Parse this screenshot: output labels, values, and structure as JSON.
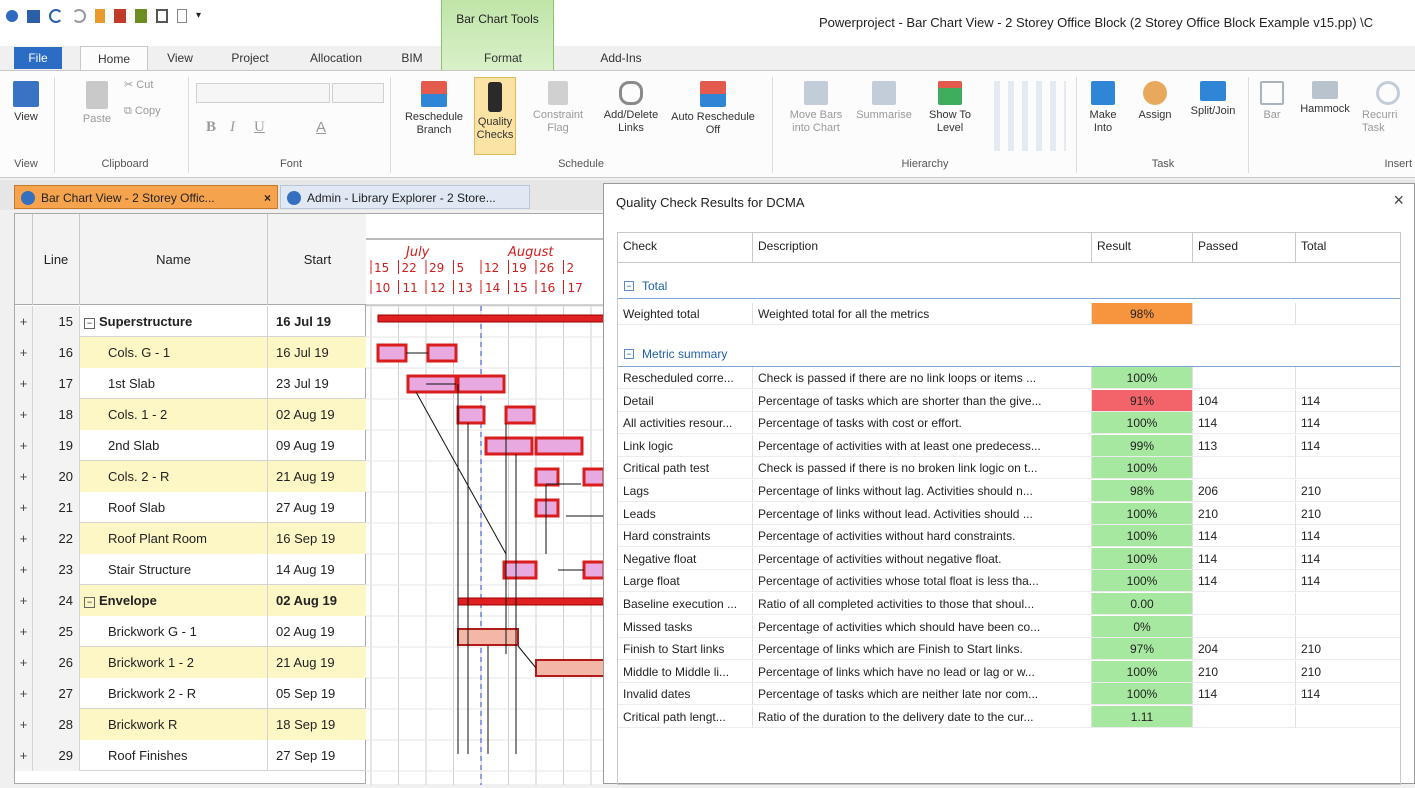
{
  "titlebar": {
    "window_title": "Powerproject - Bar Chart View - 2 Storey Office Block (2 Storey Office Block Example v15.pp) \\C",
    "context_tab_group": "Bar Chart Tools"
  },
  "tabs": [
    "File",
    "Home",
    "View",
    "Project",
    "Allocation",
    "BIM",
    "Format",
    "Add-Ins"
  ],
  "ribbon": {
    "view_label": "View",
    "clipboard": {
      "paste": "Paste",
      "cut": "Cut",
      "copy": "Copy",
      "group": "Clipboard"
    },
    "font": {
      "bold": "B",
      "italic": "I",
      "underline": "U",
      "font_color": "A",
      "group": "Font"
    },
    "schedule": {
      "reschedule": "Reschedule Branch",
      "quality": "Quality Checks",
      "constraint": "Constraint Flag",
      "links": "Add/Delete Links",
      "auto": "Auto Reschedule Off",
      "group": "Schedule"
    },
    "hierarchy": {
      "move": "Move Bars into Chart",
      "summarise": "Summarise",
      "show": "Show To Level",
      "group": "Hierarchy"
    },
    "task": {
      "make": "Make Into",
      "assign": "Assign",
      "split": "Split/Join",
      "group": "Task"
    },
    "insert": {
      "bar": "Bar",
      "hammock": "Hammock",
      "recurring": "Recurri Task",
      "group": "Insert"
    }
  },
  "doc_tabs": [
    {
      "label": "Bar Chart View - 2 Storey Offic...",
      "close": "×"
    },
    {
      "label": "Admin - Library Explorer - 2 Store..."
    }
  ],
  "grid": {
    "headers": {
      "line": "Line",
      "name": "Name",
      "start": "Start"
    },
    "rows": [
      {
        "plus": "+",
        "line": "15",
        "name": "Superstructure",
        "start": "16 Jul 19",
        "summary": true
      },
      {
        "plus": "+",
        "line": "16",
        "name": "Cols. G - 1",
        "start": "16 Jul 19"
      },
      {
        "plus": "+",
        "line": "17",
        "name": "1st Slab",
        "start": "23 Jul 19"
      },
      {
        "plus": "+",
        "line": "18",
        "name": "Cols. 1 - 2",
        "start": "02 Aug 19"
      },
      {
        "plus": "+",
        "line": "19",
        "name": "2nd Slab",
        "start": "09 Aug 19"
      },
      {
        "plus": "+",
        "line": "20",
        "name": "Cols. 2 - R",
        "start": "21 Aug 19"
      },
      {
        "plus": "+",
        "line": "21",
        "name": "Roof Slab",
        "start": "27 Aug 19"
      },
      {
        "plus": "+",
        "line": "22",
        "name": "Roof Plant Room",
        "start": "16 Sep 19"
      },
      {
        "plus": "+",
        "line": "23",
        "name": "Stair Structure",
        "start": "14 Aug 19"
      },
      {
        "plus": "+",
        "line": "24",
        "name": "Envelope",
        "start": "02 Aug 19",
        "summary": true
      },
      {
        "plus": "+",
        "line": "25",
        "name": "Brickwork G - 1",
        "start": "02 Aug 19"
      },
      {
        "plus": "+",
        "line": "26",
        "name": "Brickwork 1 - 2",
        "start": "21 Aug 19"
      },
      {
        "plus": "+",
        "line": "27",
        "name": "Brickwork 2 - R",
        "start": "05 Sep 19"
      },
      {
        "plus": "+",
        "line": "28",
        "name": "Brickwork R",
        "start": "18 Sep 19"
      },
      {
        "plus": "+",
        "line": "29",
        "name": "Roof Finishes",
        "start": "27 Sep 19"
      }
    ]
  },
  "timescale": {
    "months": [
      "July",
      "August"
    ],
    "days": [
      "15",
      "22",
      "29",
      "5",
      "12",
      "19",
      "26",
      "2"
    ],
    "weeks": [
      "10",
      "11",
      "12",
      "13",
      "14",
      "15",
      "16",
      "17"
    ]
  },
  "dialog": {
    "title": "Quality Check Results for DCMA",
    "close": "×",
    "columns": [
      "Check",
      "Description",
      "Result",
      "Passed",
      "Total"
    ],
    "groups": {
      "total": "Total",
      "metrics": "Metric summary"
    },
    "weighted": {
      "check": "Weighted total",
      "desc": "Weighted total for all the metrics",
      "result": "98%",
      "passed": "",
      "total": "",
      "color": "#f7953f"
    },
    "metrics": [
      {
        "check": "Rescheduled corre...",
        "desc": "Check is passed if there are no link loops or items ...",
        "result": "100%",
        "passed": "",
        "total": "",
        "color": "#a6e8a0"
      },
      {
        "check": "Detail",
        "desc": "Percentage of tasks which are shorter than the give...",
        "result": "91%",
        "passed": "104",
        "total": "114",
        "color": "#f2646a"
      },
      {
        "check": "All activities resour...",
        "desc": "Percentage of tasks with cost or effort.",
        "result": "100%",
        "passed": "114",
        "total": "114",
        "color": "#a6e8a0"
      },
      {
        "check": "Link logic",
        "desc": "Percentage of activities with at least one predecess...",
        "result": "99%",
        "passed": "113",
        "total": "114",
        "color": "#a6e8a0"
      },
      {
        "check": "Critical path test",
        "desc": "Check is passed if there is no broken link logic on t...",
        "result": "100%",
        "passed": "",
        "total": "",
        "color": "#a6e8a0"
      },
      {
        "check": "Lags",
        "desc": "Percentage of links without lag. Activities should n...",
        "result": "98%",
        "passed": "206",
        "total": "210",
        "color": "#a6e8a0"
      },
      {
        "check": "Leads",
        "desc": "Percentage of links without lead. Activities should ...",
        "result": "100%",
        "passed": "210",
        "total": "210",
        "color": "#a6e8a0"
      },
      {
        "check": "Hard constraints",
        "desc": "Percentage of activities without hard constraints.",
        "result": "100%",
        "passed": "114",
        "total": "114",
        "color": "#a6e8a0"
      },
      {
        "check": "Negative float",
        "desc": "Percentage of activities without negative float.",
        "result": "100%",
        "passed": "114",
        "total": "114",
        "color": "#a6e8a0"
      },
      {
        "check": "Large float",
        "desc": "Percentage of activities whose total float is less tha...",
        "result": "100%",
        "passed": "114",
        "total": "114",
        "color": "#a6e8a0"
      },
      {
        "check": "Baseline execution ...",
        "desc": "Ratio of all completed activities to those that shoul...",
        "result": "0.00",
        "passed": "",
        "total": "",
        "color": "#a6e8a0"
      },
      {
        "check": "Missed tasks",
        "desc": "Percentage of activities which should have been co...",
        "result": "0%",
        "passed": "",
        "total": "",
        "color": "#a6e8a0"
      },
      {
        "check": "Finish to Start links",
        "desc": "Percentage of links which are Finish to Start links.",
        "result": "97%",
        "passed": "204",
        "total": "210",
        "color": "#a6e8a0"
      },
      {
        "check": "Middle to Middle li...",
        "desc": "Percentage of links which have no lead or lag or w...",
        "result": "100%",
        "passed": "210",
        "total": "210",
        "color": "#a6e8a0"
      },
      {
        "check": "Invalid dates",
        "desc": "Percentage of tasks which are neither late nor com...",
        "result": "100%",
        "passed": "114",
        "total": "114",
        "color": "#a6e8a0"
      },
      {
        "check": "Critical path lengt...",
        "desc": "Ratio of the duration to the delivery date to the cur...",
        "result": "1.11",
        "passed": "",
        "total": "",
        "color": "#a6e8a0"
      }
    ]
  }
}
